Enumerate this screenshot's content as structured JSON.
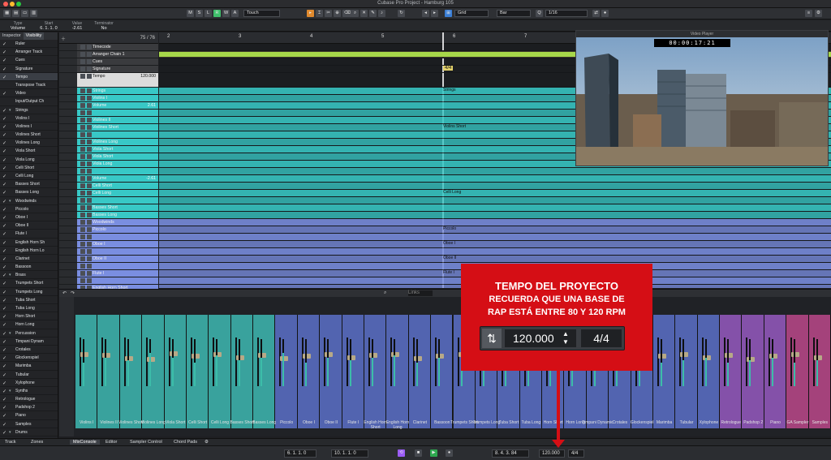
{
  "window": {
    "title": "Cubase Pro Project - Hamburg 105"
  },
  "toolbar": {
    "mode_buttons": [
      "M",
      "S",
      "L",
      "R",
      "W",
      "A"
    ],
    "automation_mode": "Touch",
    "snap_type": "Grid",
    "grid_type": "Bar",
    "quantize": "1/16"
  },
  "infoline": {
    "type_label": "Type",
    "type_value": "Volume",
    "start_label": "Start",
    "start_value": "6. 1. 1. 0",
    "value_label": "Value",
    "value_value": "-2.61",
    "terminator_label": "Terminator",
    "terminator_value": "No"
  },
  "inspector": {
    "tabs": [
      "Inspector",
      "Visibility"
    ],
    "rows": [
      {
        "label": "Ruler",
        "check": true
      },
      {
        "label": "Arranger Track",
        "check": true
      },
      {
        "label": "Cues",
        "check": true
      },
      {
        "label": "Signature",
        "check": true
      },
      {
        "label": "Tempo",
        "check": true,
        "selected": true
      },
      {
        "label": "Transpose Track",
        "check": false
      },
      {
        "label": "Video",
        "check": true
      },
      {
        "label": "Input/Output Ch",
        "check": false
      },
      {
        "label": "Strings",
        "check": true,
        "folder": true
      },
      {
        "label": "Violins I",
        "check": true
      },
      {
        "label": "Violines I",
        "check": true
      },
      {
        "label": "Violines Short",
        "check": true
      },
      {
        "label": "Violines Long",
        "check": true
      },
      {
        "label": "Viola Short",
        "check": true
      },
      {
        "label": "Viola Long",
        "check": true
      },
      {
        "label": "Celli Short",
        "check": true
      },
      {
        "label": "Celli Long",
        "check": true
      },
      {
        "label": "Basses Short",
        "check": true
      },
      {
        "label": "Basses Long",
        "check": true
      },
      {
        "label": "Woodwinds",
        "check": true,
        "folder": true
      },
      {
        "label": "Piccolo",
        "check": true
      },
      {
        "label": "Oboe I",
        "check": true
      },
      {
        "label": "Oboe II",
        "check": true
      },
      {
        "label": "Flute I",
        "check": true
      },
      {
        "label": "English Horn Sh",
        "check": true
      },
      {
        "label": "English Horn Lo",
        "check": true
      },
      {
        "label": "Clarinet",
        "check": true
      },
      {
        "label": "Bassoon",
        "check": true
      },
      {
        "label": "Brass",
        "check": true,
        "folder": true
      },
      {
        "label": "Trumpets Short",
        "check": true
      },
      {
        "label": "Trumpets Long",
        "check": true
      },
      {
        "label": "Tuba Short",
        "check": true
      },
      {
        "label": "Tuba Long",
        "check": true
      },
      {
        "label": "Horn Short",
        "check": true
      },
      {
        "label": "Horn Long",
        "check": true
      },
      {
        "label": "Percussion",
        "check": true,
        "folder": true
      },
      {
        "label": "Timpani Dynam",
        "check": true
      },
      {
        "label": "Crotales",
        "check": true
      },
      {
        "label": "Glockenspiel",
        "check": true
      },
      {
        "label": "Marimba",
        "check": true
      },
      {
        "label": "Tubular",
        "check": true
      },
      {
        "label": "Xylophone",
        "check": true
      },
      {
        "label": "Synths",
        "check": true,
        "folder": true
      },
      {
        "label": "Retrologue",
        "check": true
      },
      {
        "label": "Padshop 2",
        "check": true
      },
      {
        "label": "Piano",
        "check": true
      },
      {
        "label": "Samples",
        "check": true
      },
      {
        "label": "Drums",
        "check": true,
        "folder": true
      }
    ]
  },
  "tracklist": {
    "header_count": "75 / 76",
    "tracks": [
      {
        "name": "Timecode",
        "color": "#7d7f84",
        "h": 9
      },
      {
        "name": "Arranger Chain 1",
        "color": "#8a7d3a",
        "h": 9
      },
      {
        "name": "Cues",
        "color": "#c9b54a",
        "h": 9
      },
      {
        "name": "Signature",
        "color": "#c9b54a",
        "h": 9
      },
      {
        "name": "Tempo",
        "color": "#e8e8e8",
        "h": 18,
        "value": "120.000"
      },
      {
        "name": "Strings",
        "color": "#38c8c6",
        "h": 9
      },
      {
        "name": "Violins I",
        "color": "#38c8c6",
        "h": 9
      },
      {
        "name": "Volume",
        "color": "#38c8c6",
        "h": 9,
        "value": "2.61"
      },
      {
        "name": "",
        "color": "#38c8c6",
        "h": 9
      },
      {
        "name": "Violines II",
        "color": "#38c8c6",
        "h": 9
      },
      {
        "name": "Violines Short",
        "color": "#38c8c6",
        "h": 9
      },
      {
        "name": "",
        "color": "#38c8c6",
        "h": 9
      },
      {
        "name": "Violines Long",
        "color": "#38c8c6",
        "h": 9
      },
      {
        "name": "Viola Short",
        "color": "#38c8c6",
        "h": 9
      },
      {
        "name": "Viola Short",
        "color": "#38c8c6",
        "h": 9
      },
      {
        "name": "Viola Long",
        "color": "#38c8c6",
        "h": 9
      },
      {
        "name": "",
        "color": "#38c8c6",
        "h": 9
      },
      {
        "name": "Volume",
        "color": "#38c8c6",
        "h": 9,
        "value": "-2.61"
      },
      {
        "name": "Celli Short",
        "color": "#38c8c6",
        "h": 9
      },
      {
        "name": "Celli Long",
        "color": "#38c8c6",
        "h": 9
      },
      {
        "name": "",
        "color": "#38c8c6",
        "h": 9
      },
      {
        "name": "Basses Short",
        "color": "#38c8c6",
        "h": 9
      },
      {
        "name": "Basses Long",
        "color": "#38c8c6",
        "h": 9
      },
      {
        "name": "Woodwinds",
        "color": "#7a8ee0",
        "h": 9
      },
      {
        "name": "Piccolo",
        "color": "#7a8ee0",
        "h": 9
      },
      {
        "name": "",
        "color": "#7a8ee0",
        "h": 9
      },
      {
        "name": "Oboe I",
        "color": "#7a8ee0",
        "h": 9
      },
      {
        "name": "",
        "color": "#7a8ee0",
        "h": 9
      },
      {
        "name": "Oboe II",
        "color": "#7a8ee0",
        "h": 9
      },
      {
        "name": "",
        "color": "#7a8ee0",
        "h": 9
      },
      {
        "name": "Flute I",
        "color": "#7a8ee0",
        "h": 9
      },
      {
        "name": "",
        "color": "#7a8ee0",
        "h": 9
      },
      {
        "name": "English Horn Short",
        "color": "#7a8ee0",
        "h": 9
      }
    ]
  },
  "arrange": {
    "ruler_marks": [
      "2",
      "3",
      "4",
      "5",
      "6",
      "7",
      "8",
      "9",
      "10",
      "11"
    ],
    "event_labels": [
      {
        "text": "Strings",
        "lane": "strings"
      },
      {
        "text": "Violins Short",
        "lane": "violshort"
      },
      {
        "text": "Celli Long",
        "lane": "celli"
      },
      {
        "text": "Piccolo",
        "lane": "picc"
      },
      {
        "text": "Oboe I",
        "lane": "oboe1"
      },
      {
        "text": "Oboe II",
        "lane": "oboe2"
      },
      {
        "text": "Flute I",
        "lane": "flute"
      }
    ],
    "signature": "4/4"
  },
  "video": {
    "title": "Video Player",
    "timecode": "00:00:17:21"
  },
  "mixer": {
    "search_label": "Links",
    "channels": [
      {
        "name": "Violins I",
        "color": "#3fbfb8",
        "fader": 0.7,
        "meter": 0.5
      },
      {
        "name": "Violines II",
        "color": "#3fbfb8",
        "fader": 0.68,
        "meter": 0.6
      },
      {
        "name": "Violines Short",
        "color": "#3fbfb8",
        "fader": 0.62,
        "meter": 0.55
      },
      {
        "name": "Violines Long",
        "color": "#3fbfb8",
        "fader": 0.6,
        "meter": 0.7
      },
      {
        "name": "Viola Short",
        "color": "#3fbfb8",
        "fader": 0.72,
        "meter": 0.6
      },
      {
        "name": "Celli Short",
        "color": "#3fbfb8",
        "fader": 0.66,
        "meter": 0.5
      },
      {
        "name": "Celli Long",
        "color": "#3fbfb8",
        "fader": 0.7,
        "meter": 0.65
      },
      {
        "name": "Basses Short",
        "color": "#3fbfb8",
        "fader": 0.64,
        "meter": 0.55
      },
      {
        "name": "Basses Long",
        "color": "#3fbfb8",
        "fader": 0.68,
        "meter": 0.6
      },
      {
        "name": "Piccolo",
        "color": "#5d73cf",
        "fader": 0.62,
        "meter": 0.7
      },
      {
        "name": "Oboe I",
        "color": "#5d73cf",
        "fader": 0.66,
        "meter": 0.5
      },
      {
        "name": "Oboe II",
        "color": "#5d73cf",
        "fader": 0.7,
        "meter": 0.6
      },
      {
        "name": "Flute I",
        "color": "#5d73cf",
        "fader": 0.64,
        "meter": 0.55
      },
      {
        "name": "English Horn Short",
        "color": "#5d73cf",
        "fader": 0.68,
        "meter": 0.6
      },
      {
        "name": "English Horn Long",
        "color": "#5d73cf",
        "fader": 0.7,
        "meter": 0.65
      },
      {
        "name": "Clarinet",
        "color": "#5d73cf",
        "fader": 0.62,
        "meter": 0.5
      },
      {
        "name": "Bassoon",
        "color": "#5d73cf",
        "fader": 0.66,
        "meter": 0.6
      },
      {
        "name": "Trumpets Short",
        "color": "#5d73cf",
        "fader": 0.7,
        "meter": 0.55
      },
      {
        "name": "Trumpets Long",
        "color": "#5d73cf",
        "fader": 0.64,
        "meter": 0.6
      },
      {
        "name": "Tuba Short",
        "color": "#5d73cf",
        "fader": 0.68,
        "meter": 0.7
      },
      {
        "name": "Tuba Long",
        "color": "#5d73cf",
        "fader": 0.6,
        "meter": 0.5
      },
      {
        "name": "Horn Short",
        "color": "#5d73cf",
        "fader": 0.66,
        "meter": 0.55
      },
      {
        "name": "Horn Long",
        "color": "#5d73cf",
        "fader": 0.7,
        "meter": 0.6
      },
      {
        "name": "Timpani Dynamic",
        "color": "#5d73cf",
        "fader": 0.64,
        "meter": 0.5
      },
      {
        "name": "Crotales",
        "color": "#5d73cf",
        "fader": 0.68,
        "meter": 0.55
      },
      {
        "name": "Glockenspiel",
        "color": "#5d73cf",
        "fader": 0.62,
        "meter": 0.6
      },
      {
        "name": "Marimba",
        "color": "#5d73cf",
        "fader": 0.66,
        "meter": 0.5
      },
      {
        "name": "Tubular",
        "color": "#5d73cf",
        "fader": 0.7,
        "meter": 0.55
      },
      {
        "name": "Xylophone",
        "color": "#5d73cf",
        "fader": 0.64,
        "meter": 0.6
      },
      {
        "name": "Retrologue",
        "color": "#9a5cc6",
        "fader": 0.68,
        "meter": 0.5
      },
      {
        "name": "Padshop 2",
        "color": "#9a5cc6",
        "fader": 0.6,
        "meter": 0.55
      },
      {
        "name": "Piano",
        "color": "#9a5cc6",
        "fader": 0.66,
        "meter": 0.6
      },
      {
        "name": "GA Sampler",
        "color": "#c24a8e",
        "fader": 0.7,
        "meter": 0.5
      },
      {
        "name": "Samples",
        "color": "#c24a8e",
        "fader": 0.64,
        "meter": 0.55
      }
    ]
  },
  "bottom_tabs": [
    "Track",
    "Zones",
    "MixConsole",
    "Editor",
    "Sampler Control",
    "Chord Pads"
  ],
  "transport": {
    "left_locator": "6. 1. 1. 0",
    "right_locator": "10. 1. 1. 0",
    "position": "8. 4. 3. 84",
    "tempo": "120.000",
    "signature": "4/4"
  },
  "overlay": {
    "title": "TEMPO DEL PROYECTO",
    "line1": "RECUERDA QUE UNA BASE DE",
    "line2": "RAP ESTÁ ENTRE 80 Y 120 RPM",
    "tempo": "120.000",
    "signature": "4/4",
    "color": "#d50e15"
  }
}
